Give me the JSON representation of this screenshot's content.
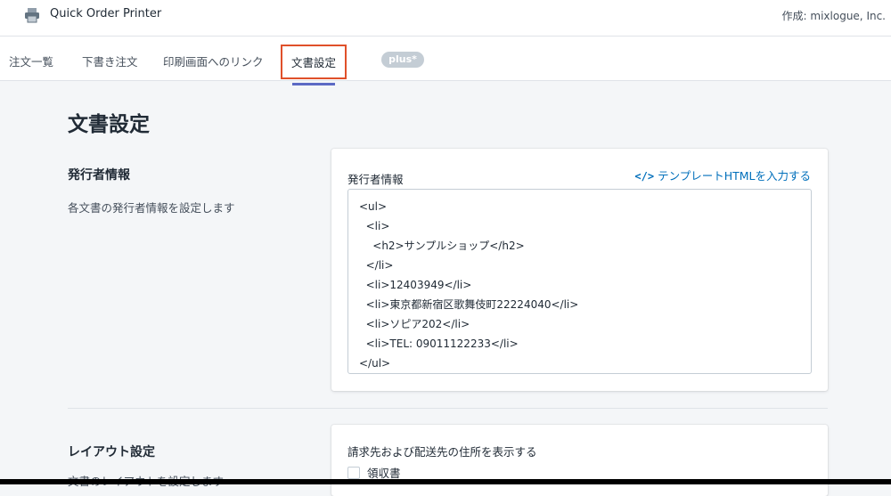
{
  "app": {
    "title": "Quick Order Printer",
    "author": "作成: mixlogue, Inc.",
    "icon": "printer-icon"
  },
  "nav": {
    "tabs": [
      {
        "label": "注文一覧"
      },
      {
        "label": "下書き注文"
      },
      {
        "label": "印刷画面へのリンク"
      },
      {
        "label": "文書設定",
        "active": true
      }
    ],
    "plus_badge": "plus*"
  },
  "page": {
    "title": "文書設定"
  },
  "issuer": {
    "section_title": "発行者情報",
    "section_desc": "各文書の発行者情報を設定します",
    "field_label": "発行者情報",
    "template_link": "テンプレートHTMLを入力する",
    "template_icon": "</>",
    "html_value": "<ul>\n  <li>\n    <h2>サンプルショップ</h2>\n  </li>\n  <li>12403949</li>\n  <li>東京都新宿区歌舞伎町22224040</li>\n  <li>ソピア202</li>\n  <li>TEL: 09011122233</li>\n</ul>"
  },
  "layout": {
    "section_title": "レイアウト設定",
    "section_desc": "文書のレイアウトを設定します",
    "check_label": "請求先および配送先の住所を表示する",
    "checkbox_label": "領収書",
    "checkbox_checked": false
  },
  "colors": {
    "accent": "#5c6ac4",
    "highlight": "#e0502a",
    "link": "#006fbb"
  }
}
